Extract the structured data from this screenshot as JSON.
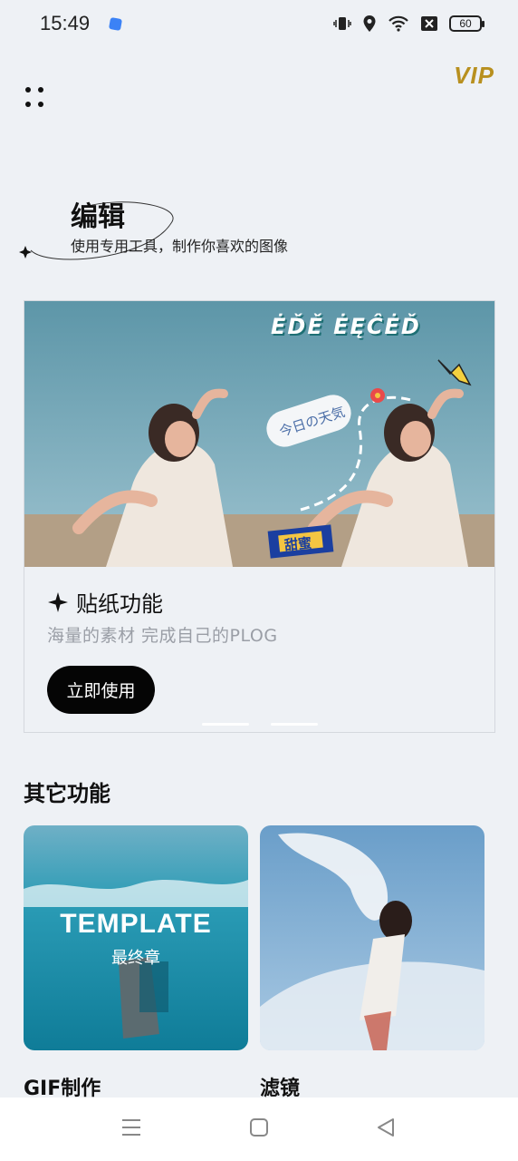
{
  "status_bar": {
    "time": "15:49",
    "battery": "60"
  },
  "header": {
    "vip_label": "VIP"
  },
  "hero": {
    "title": "编辑",
    "subtitle": "使用专用工具，制作你喜欢的图像"
  },
  "feature": {
    "sticker_banner_text": "ĖĎĚ ĖĘĈĖĎ",
    "cloud_text": "今日の天気",
    "tag_text": "甜蜜",
    "title": "贴纸功能",
    "description": "海量的素材 完成自己的PLOG",
    "button_label": "立即使用"
  },
  "other": {
    "section_title": "其它功能",
    "items": [
      {
        "label": "GIF制作",
        "image_title": "TEMPLATE",
        "image_subtitle": "最终章"
      },
      {
        "label": "滤镜"
      }
    ]
  },
  "colors": {
    "accent_vip": "#b8901f",
    "button_bg": "#050505",
    "background": "#eef1f5"
  }
}
